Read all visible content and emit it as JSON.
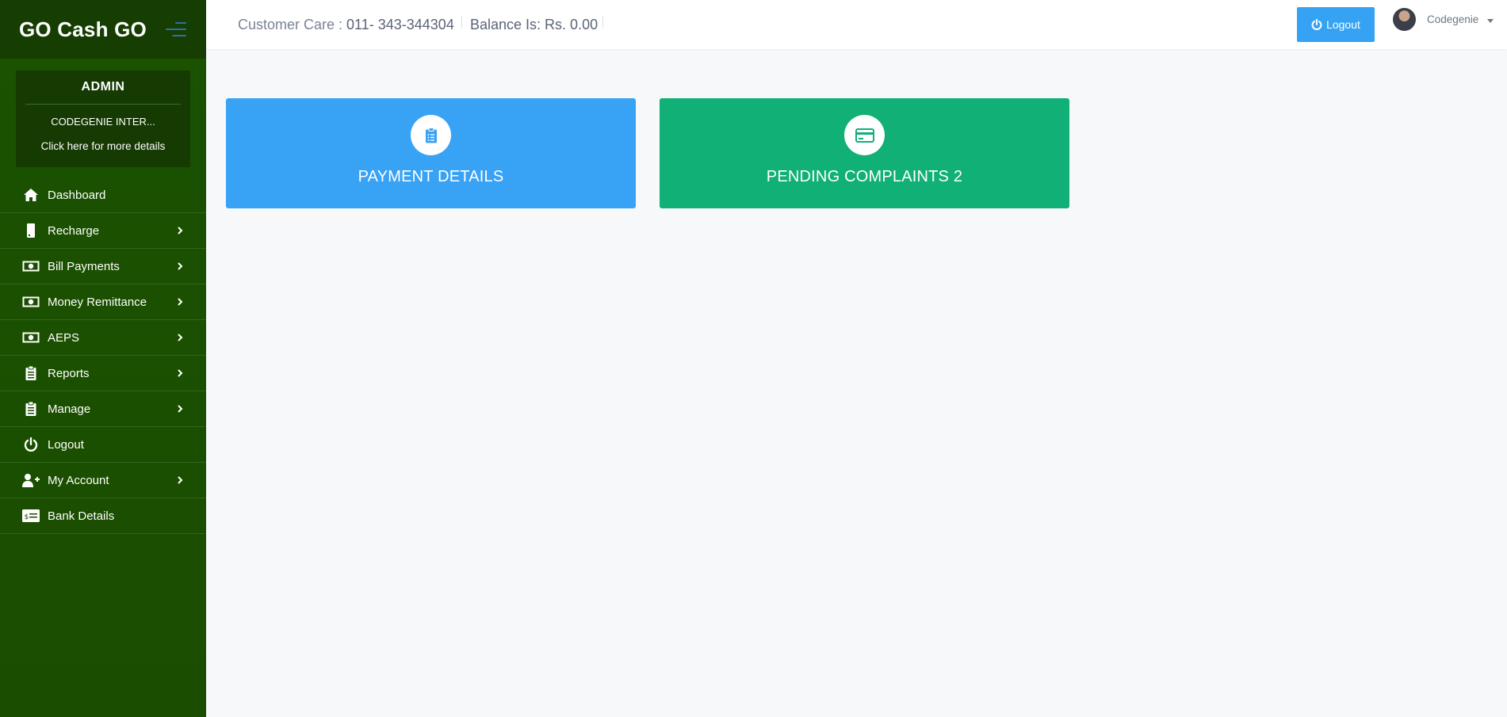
{
  "brand": "GO Cash GO",
  "profile": {
    "role": "ADMIN",
    "company": "CODEGENIE INTER...",
    "details_link": "Click here for more details"
  },
  "nav": [
    {
      "label": "Dashboard",
      "icon": "home-icon",
      "has_submenu": false
    },
    {
      "label": "Recharge",
      "icon": "mobile-icon",
      "has_submenu": true
    },
    {
      "label": "Bill Payments",
      "icon": "money-icon",
      "has_submenu": true
    },
    {
      "label": "Money Remittance",
      "icon": "money-icon",
      "has_submenu": true
    },
    {
      "label": "AEPS",
      "icon": "money-icon",
      "has_submenu": true
    },
    {
      "label": "Reports",
      "icon": "clipboard-icon",
      "has_submenu": true
    },
    {
      "label": "Manage",
      "icon": "clipboard-icon",
      "has_submenu": true
    },
    {
      "label": "Logout",
      "icon": "power-icon",
      "has_submenu": false
    },
    {
      "label": "My Account",
      "icon": "user-plus-icon",
      "has_submenu": true
    },
    {
      "label": "Bank Details",
      "icon": "money-check-icon",
      "has_submenu": false
    }
  ],
  "topbar": {
    "care_label": "Customer Care : ",
    "care_number": "011- 343-344304",
    "balance": "Balance Is: Rs. 0.00",
    "logout_label": "Logout",
    "username": "Codegenie"
  },
  "cards": [
    {
      "label": "PAYMENT DETAILS",
      "icon": "clipboard-list-icon",
      "color": "#38a2f4"
    },
    {
      "label": "PENDING COMPLAINTS 2",
      "icon": "credit-card-icon",
      "color": "#11b076"
    }
  ],
  "colors": {
    "sidebar": "#1b4d00",
    "accent_blue": "#35a2f4",
    "accent_green": "#11b076"
  }
}
